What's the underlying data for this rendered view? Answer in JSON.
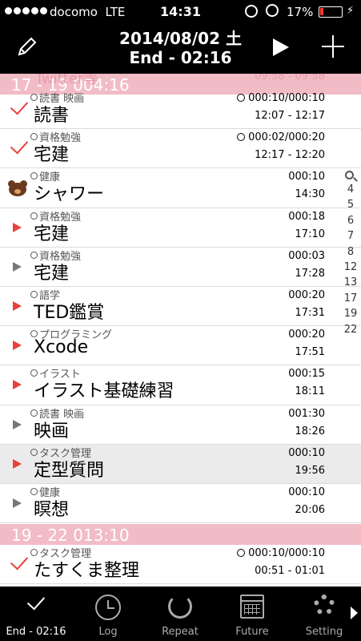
{
  "status_bar": {
    "carrier": "docomo",
    "network": "LTE",
    "time": "14:31",
    "battery_text": "17%",
    "battery_level": 0.17,
    "battery_color": "#ff3b30"
  },
  "header": {
    "date": "2014/08/02 土",
    "end": "End - 02:16",
    "icons": [
      "pencil-icon",
      "play-icon",
      "plus-icon"
    ]
  },
  "sections": [
    {
      "label": "17 - 19   004:16",
      "ghost_left": "Twitter等",
      "ghost_right": "09:58 - 09:58"
    },
    {
      "label": "19 - 22   013:10"
    }
  ],
  "rows": [
    {
      "mark": "check",
      "category": "読書 映画",
      "name": "読書",
      "duration": "000:10/000:10",
      "timer": true,
      "time": "12:07 - 12:17"
    },
    {
      "mark": "check",
      "category": "資格勉強",
      "name": "宅建",
      "duration": "000:02/000:20",
      "timer": true,
      "time": "12:17 - 12:20"
    },
    {
      "mark": "bear",
      "category": "健康",
      "name": "シャワー",
      "duration": "000:10",
      "timer": false,
      "time": "14:30"
    },
    {
      "mark": "red",
      "category": "資格勉強",
      "name": "宅建",
      "duration": "000:18",
      "timer": false,
      "time": "17:10"
    },
    {
      "mark": "gray",
      "category": "資格勉強",
      "name": "宅建",
      "duration": "000:03",
      "timer": false,
      "time": "17:28"
    },
    {
      "mark": "red",
      "category": "語学",
      "name": "TED鑑賞",
      "duration": "000:20",
      "timer": false,
      "time": "17:31"
    },
    {
      "mark": "red",
      "category": "プログラミング",
      "name": "Xcode",
      "duration": "000:20",
      "timer": false,
      "time": "17:51"
    },
    {
      "mark": "red",
      "category": "イラスト",
      "name": "イラスト基礎練習",
      "duration": "000:15",
      "timer": false,
      "time": "18:11"
    },
    {
      "mark": "gray",
      "category": "読書 映画",
      "name": "映画",
      "duration": "001:30",
      "timer": false,
      "time": "18:26"
    },
    {
      "mark": "red",
      "category": "タスク管理",
      "name": "定型質問",
      "duration": "000:10",
      "timer": false,
      "time": "19:56",
      "highlight": true
    },
    {
      "mark": "gray",
      "category": "健康",
      "name": "瞑想",
      "duration": "000:10",
      "timer": false,
      "time": "20:06"
    },
    {
      "mark": "check",
      "category": "タスク管理",
      "name": "たすくま整理",
      "duration": "000:10/000:10",
      "timer": true,
      "time": "00:51 - 01:01"
    }
  ],
  "section_index": [
    "4",
    "5",
    "6",
    "7",
    "8",
    "12",
    "13",
    "17",
    "19",
    "22"
  ],
  "tabs": [
    {
      "label": "End - 02:16",
      "icon": "check-icon",
      "active": true
    },
    {
      "label": "Log",
      "icon": "clock-icon",
      "active": false
    },
    {
      "label": "Repeat",
      "icon": "repeat-icon",
      "active": false
    },
    {
      "label": "Future",
      "icon": "calendar-icon",
      "active": false
    },
    {
      "label": "Setting",
      "icon": "gear-icon",
      "active": false
    }
  ],
  "colors": {
    "section": "#f2bcc6",
    "check": "#e8413e",
    "highlight_row": "#ebebeb"
  }
}
